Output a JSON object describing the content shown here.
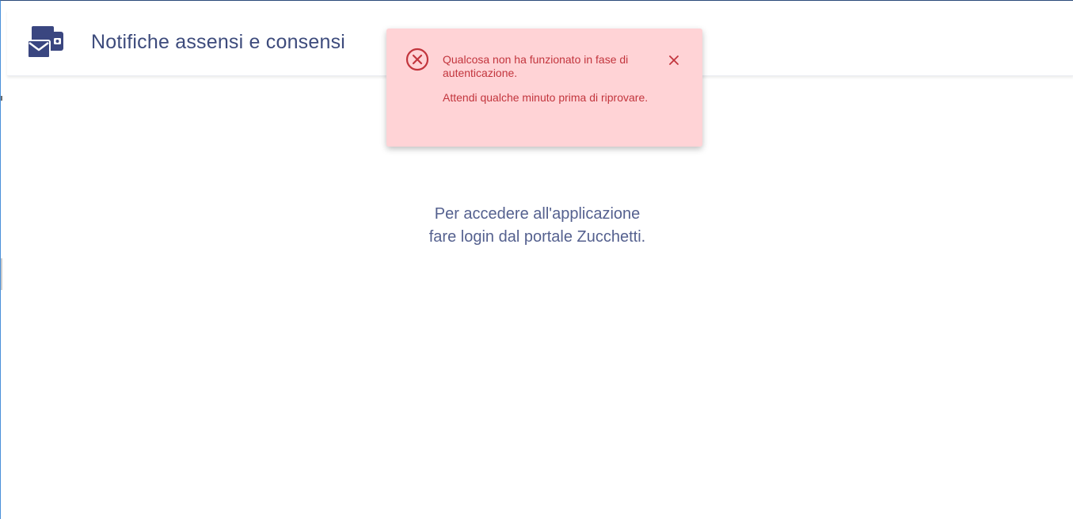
{
  "header": {
    "title": "Notifiche assensi e consensi",
    "icon": "mail-wallet-icon"
  },
  "main": {
    "message_line1": "Per accedere all'applicazione",
    "message_line2": "fare login dal portale Zucchetti."
  },
  "toast": {
    "type": "error",
    "icon": "error-circle-x-icon",
    "close_icon": "close-icon",
    "message1": "Qualcosa non ha funzionato in fase di autenticazione.",
    "message2": "Attendi qualche minuto prima di riprovare."
  },
  "colors": {
    "brand": "#3d4b7c",
    "toast_background": "#ffd3d6",
    "toast_text": "#c2353d"
  }
}
